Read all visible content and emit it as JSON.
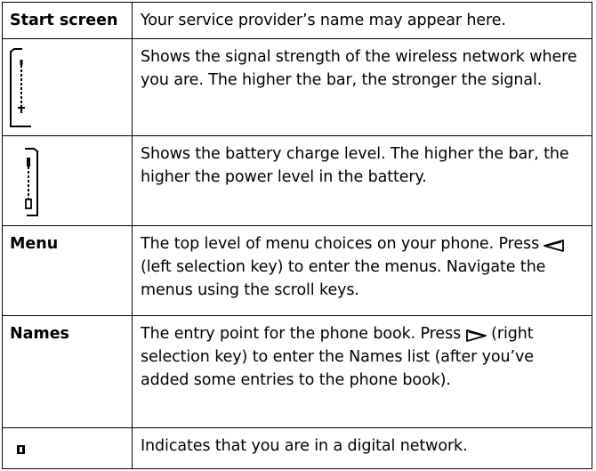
{
  "rows": [
    {
      "icon": null,
      "label": "Start screen",
      "text": "Your service provider’s name may appear here."
    },
    {
      "icon": "signal-strength-icon",
      "label": null,
      "text": "Shows the signal strength of the wireless network where you are. The higher the bar, the stronger the signal."
    },
    {
      "icon": "battery-level-icon",
      "label": null,
      "text": "Shows the battery charge level. The higher the bar, the higher the power level in the battery."
    },
    {
      "icon": null,
      "label": "Menu",
      "text_before": "The top level of menu choices on your phone. Press",
      "key_icon": "left-selection-key-icon",
      "text_after": "(left selection key) to enter the menus. Navigate the menus using the scroll keys."
    },
    {
      "icon": null,
      "label": "Names",
      "text_before": "The entry point for the phone book. Press",
      "key_icon": "right-selection-key-icon",
      "text_after": "(right selection key) to enter the Names list (after you’ve added some entries to the phone book)."
    },
    {
      "icon": "digital-network-icon",
      "label": null,
      "text": "Indicates that you are in a digital network."
    }
  ]
}
